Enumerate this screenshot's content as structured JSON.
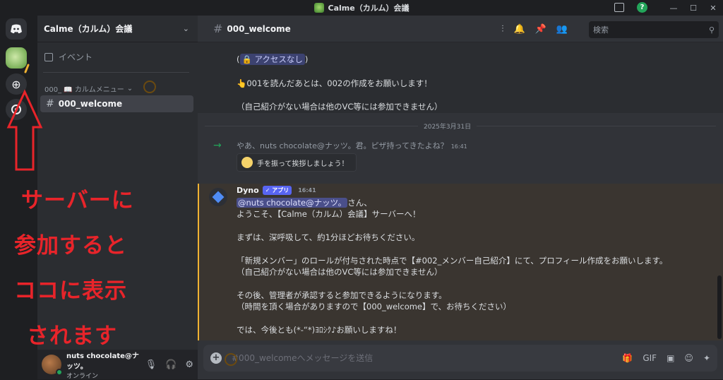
{
  "titlebar": {
    "title": "Calme（カルム）会議"
  },
  "server": {
    "name": "Calme（カルム）会議"
  },
  "sidebar": {
    "events_label": "イベント",
    "category_label": "000_ 📖 カルムメニュー",
    "selected_channel": "000_welcome"
  },
  "user": {
    "name": "nuts chocolate@ナッツ。",
    "status": "オンライン"
  },
  "chat": {
    "channel_name": "000_welcome",
    "search_placeholder": "検索",
    "top_message": {
      "line1_open": "(",
      "line1_pill": "🔒 アクセスなし",
      "line1_close": ")",
      "line2": "👆001を読んだあとは、002の作成をお願いします！",
      "line3": "（自己紹介がない場合は他のVC等には参加できません）"
    },
    "date_divider": "2025年3月31日",
    "join_message": {
      "prefix": "やあ、",
      "user": "nuts chocolate@ナッツ",
      "suffix": "。君。ピザ持ってきたよね？",
      "time": "16:41",
      "wave_button": "手を振って挨拶しましょう！"
    },
    "dyno_message": {
      "author": "Dyno",
      "badge": "✓ アプリ",
      "time": "16:41",
      "mention": "@nuts chocolate@ナッツ。",
      "mention_suffix": "さん、",
      "line2": "ようこそ、【Calme（カルム）会議】サーバーへ！",
      "line3": "まずは、深呼吸して、約1分ほどお待ちください。",
      "line4": "「新規メンバー」のロールが付与された時点で【#002_メンバー自己紹介】にて、プロフィール作成をお願いします。",
      "line5": "（自己紹介がない場合は他のVC等には参加できません）",
      "line6": "その後、管理者が承認すると参加できるようになります。",
      "line7": "（時間を頂く場合がありますので【000_welcome】で、お待ちください）",
      "line8": "では、今後とも(*-“*)ﾖﾛｼｸ♪お願いしますね！"
    },
    "composer_placeholder": "#000_welcomeへメッセージを送信"
  },
  "annotation": {
    "line1": "サーバーに",
    "line2": "参加すると",
    "line3": "ココに表示",
    "line4": "されます",
    "color": "#e8242a"
  }
}
